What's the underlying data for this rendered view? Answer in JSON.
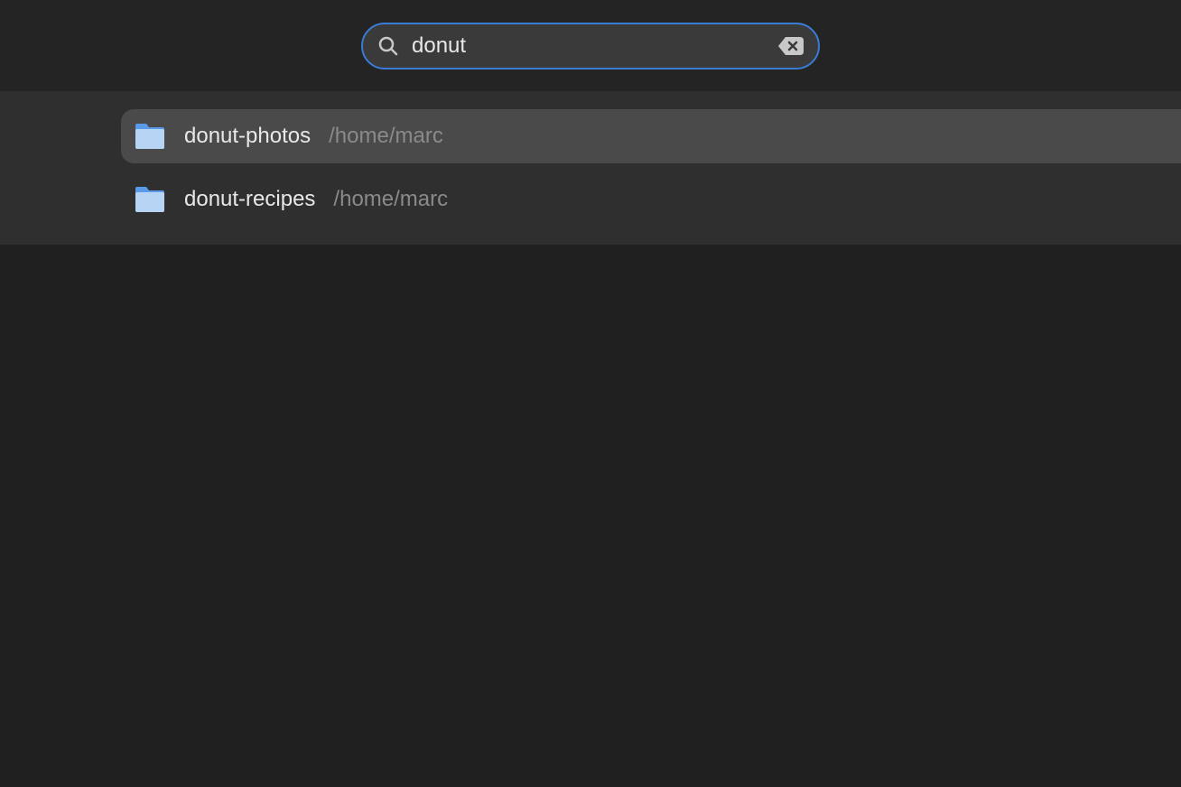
{
  "search": {
    "value": "donut"
  },
  "results": [
    {
      "name": "donut-photos",
      "path": "/home/marc",
      "selected": true
    },
    {
      "name": "donut-recipes",
      "path": "/home/marc",
      "selected": false
    }
  ]
}
